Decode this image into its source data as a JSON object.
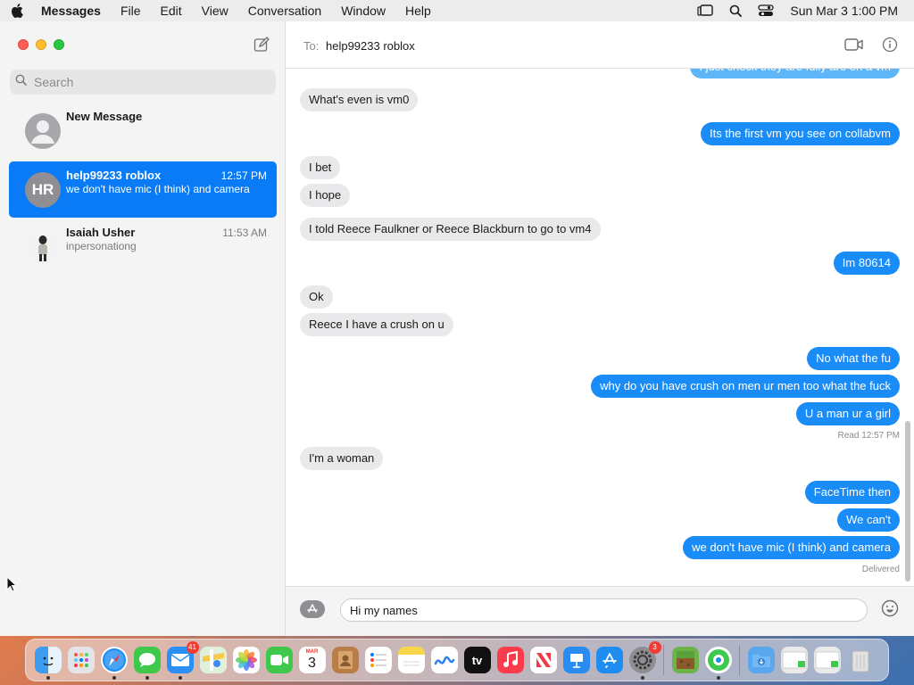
{
  "menubar": {
    "app_name": "Messages",
    "menus": [
      "File",
      "Edit",
      "View",
      "Conversation",
      "Window",
      "Help"
    ],
    "clock": "Sun Mar 3  1:00 PM"
  },
  "sidebar": {
    "search": {
      "placeholder": "Search"
    },
    "conversations": [
      {
        "name": "New Message",
        "time": "",
        "preview": "",
        "avatar": "person-silhouette"
      },
      {
        "name": "help99233 roblox",
        "time": "12:57 PM",
        "preview": "we don't have mic (I think) and camera",
        "avatar_initials": "HR",
        "selected": true
      },
      {
        "name": "Isaiah Usher",
        "time": "11:53 AM",
        "preview": "inpersonationg",
        "avatar": "photo"
      }
    ]
  },
  "chat": {
    "to_label": "To:",
    "recipient": "help99233 roblox",
    "messages": [
      {
        "dir": "out",
        "text": "I just check they are fully are on a vm"
      },
      {
        "dir": "in",
        "text": "What's even is vm0"
      },
      {
        "dir": "out",
        "text": "Its the first vm you see on collabvm"
      },
      {
        "dir": "in",
        "text": "I bet"
      },
      {
        "dir": "in",
        "text": "I hope"
      },
      {
        "dir": "in",
        "text": "I told Reece Faulkner or Reece Blackburn to go to vm4"
      },
      {
        "dir": "out",
        "text": "Im 80614"
      },
      {
        "dir": "in",
        "text": "Ok"
      },
      {
        "dir": "in",
        "text": "Reece I have a crush on u"
      },
      {
        "dir": "out",
        "text": "No what the fu"
      },
      {
        "dir": "out",
        "text": "why do you have crush   on men ur men too what the fuck"
      },
      {
        "dir": "out",
        "text": "U a man ur a girl"
      },
      {
        "dir": "in",
        "text": "I'm a woman"
      },
      {
        "dir": "out",
        "text": "FaceTime then"
      },
      {
        "dir": "out",
        "text": "We can't"
      },
      {
        "dir": "out",
        "text": "we don't have mic (I think) and camera"
      }
    ],
    "read_label": "Read",
    "read_time": "12:57 PM",
    "delivered_label": "Delivered",
    "composer_value": "Hi my names"
  },
  "dock": {
    "calendar_month": "MAR",
    "calendar_day": "3",
    "mail_badge": "41",
    "settings_badge": "3",
    "tv_label": "tv"
  }
}
